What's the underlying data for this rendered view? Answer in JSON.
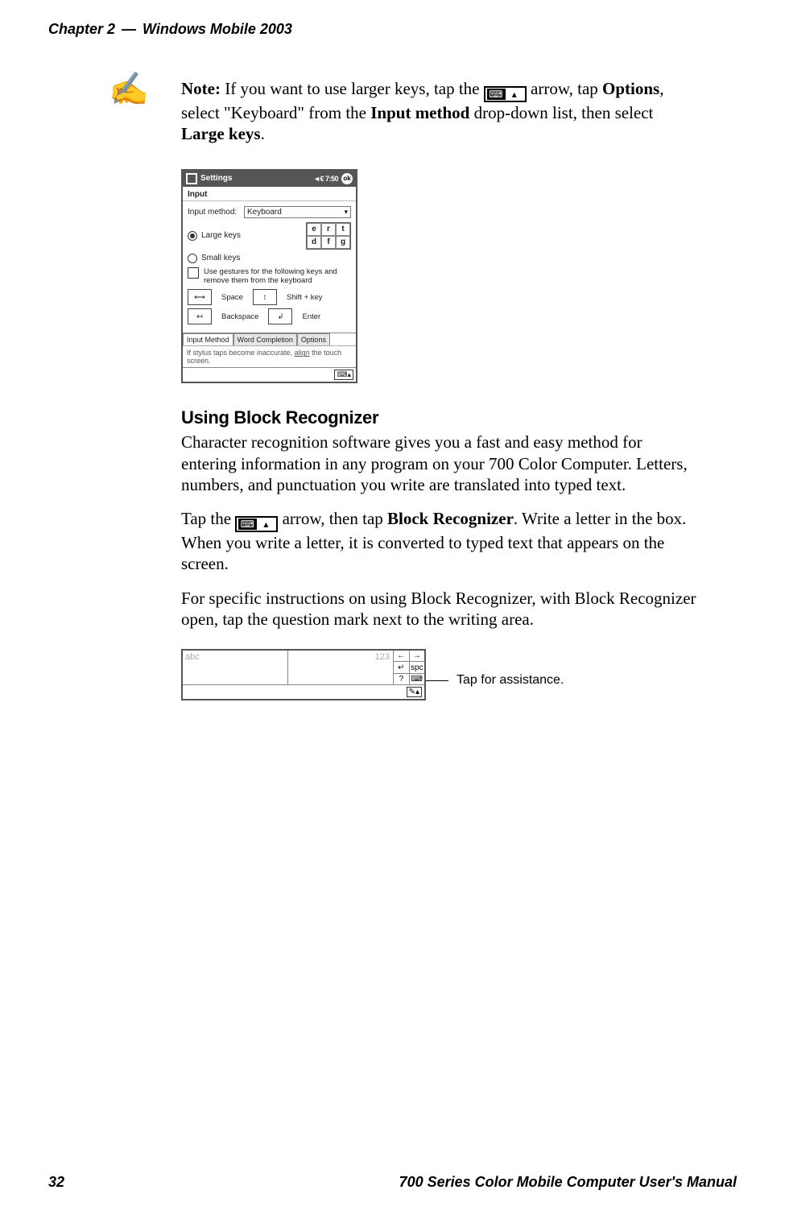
{
  "header": {
    "chapter_label": "Chapter 2",
    "dash": "—",
    "title": "Windows Mobile 2003"
  },
  "note": {
    "prefix": "Note:",
    "part1": " If you want to use larger keys, tap the ",
    "part2": " arrow, tap ",
    "options_word": "Options",
    "part3": ", select \"Keyboard\" from the ",
    "input_method_bold": "Input method",
    "part4": " drop-down list, then select ",
    "large_keys_bold": "Large keys",
    "part5": "."
  },
  "screenshot": {
    "titlebar_app": "Settings",
    "status": "◄€ 7:50",
    "ok": "ok",
    "app_name": "Input",
    "input_method_label": "Input method:",
    "combo_value": "Keyboard",
    "radio_large": "Large keys",
    "radio_small": "Small keys",
    "keygrid": [
      "e",
      "r",
      "t",
      "d",
      "f",
      "g"
    ],
    "gesture_check_text": "Use gestures for the following keys and remove them from the keyboard",
    "g_space": "Space",
    "g_shift": "Shift + key",
    "g_back": "Backspace",
    "g_enter": "Enter",
    "tabs": [
      "Input Method",
      "Word Completion",
      "Options"
    ],
    "help": "If stylus taps become inaccurate, ",
    "help_link": "align",
    "help2": " the touch screen."
  },
  "section": {
    "title": "Using Block Recognizer",
    "p1": "Character recognition software gives you a fast and easy method for entering information in any program on your 700 Color Computer. Letters, numbers, and punctuation you write are translated into typed text.",
    "p2_a": "Tap the ",
    "p2_b": " arrow, then tap ",
    "p2_bold": "Block Recognizer",
    "p2_c": ". Write a letter in the box. When you write a letter, it is converted to typed text that appears on the screen.",
    "p3": "For specific instructions on using Block Recognizer, with Block Recognizer open, tap the question mark next to the writing area."
  },
  "block_rec": {
    "abc": "abc",
    "num": "123",
    "side": {
      "r1c1": "←",
      "r1c2": "→",
      "r2c1": "↵",
      "r2c2": "spc",
      "r3c1": "?",
      "r3c2": "⌨"
    },
    "pen": "✎▴"
  },
  "assist_caption": "Tap for assistance.",
  "footer": {
    "page_no": "32",
    "manual_title": "700 Series Color Mobile Computer User's Manual"
  }
}
